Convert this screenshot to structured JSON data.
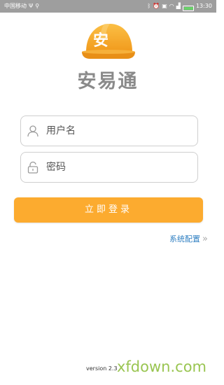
{
  "status_bar": {
    "carrier": "中国移动",
    "icons_left": [
      "usb-icon",
      "usb-icon"
    ],
    "icons_right": [
      "bluetooth-icon",
      "alarm-icon",
      "nfc-icon",
      "wifi-icon",
      "signal-icon"
    ],
    "battery_level": "99",
    "time": "13:30"
  },
  "logo": {
    "helmet_char": "安",
    "app_name": "安易通",
    "helmet_color": "#f7a623"
  },
  "login_form": {
    "username_placeholder": "用户名",
    "password_placeholder": "密码",
    "login_label": "立即登录"
  },
  "settings_link": {
    "label": "系统配置",
    "arrow": "»"
  },
  "footer": {
    "version": "version 2.3",
    "watermark": "xfdown.com"
  },
  "colors": {
    "accent": "#fcab2f",
    "link": "#2f7fc2",
    "status_bar": "#9e9e9e"
  }
}
